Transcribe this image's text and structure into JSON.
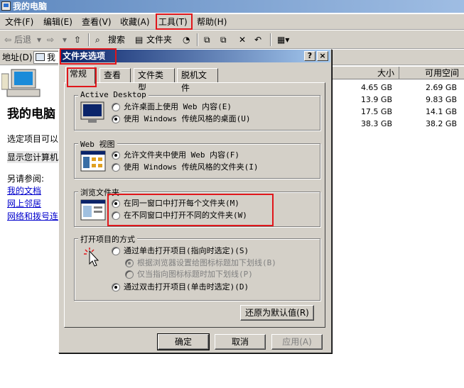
{
  "window": {
    "title": "我的电脑"
  },
  "menu": [
    "文件(F)",
    "编辑(E)",
    "查看(V)",
    "收藏(A)",
    "工具(T)",
    "帮助(H)"
  ],
  "toolbar": {
    "back": "后退",
    "search": "搜索",
    "folders": "文件夹"
  },
  "address": {
    "label": "地址(D)",
    "value": "我"
  },
  "leftpane": {
    "title": "我的电脑",
    "select_text": "选定项目可以",
    "show_text": "显示您计算机",
    "see_also": "另请参阅:",
    "links": [
      "我的文档",
      "网上邻居",
      "网络和拨号连"
    ]
  },
  "grid": {
    "headers": [
      "大小",
      "可用空间"
    ],
    "rows": [
      [
        "4.65 GB",
        "2.69 GB"
      ],
      [
        "13.9 GB",
        "9.83 GB"
      ],
      [
        "17.5 GB",
        "14.1 GB"
      ],
      [
        "38.3 GB",
        "38.2 GB"
      ]
    ]
  },
  "dialog": {
    "title": "文件夹选项",
    "help_btn": "?",
    "close_btn": "×",
    "tabs": [
      "常规",
      "查看",
      "文件类型",
      "脱机文件"
    ],
    "groups": {
      "active_desktop": {
        "title": "Active Desktop",
        "options": [
          "允许桌面上使用 Web 内容(E)",
          "使用 Windows 传统风格的桌面(U)"
        ],
        "selected": 1
      },
      "web_view": {
        "title": "Web 视图",
        "options": [
          "允许文件夹中使用 Web 内容(F)",
          "使用 Windows 传统风格的文件夹(I)"
        ],
        "selected": 0
      },
      "browse": {
        "title": "浏览文件夹",
        "options": [
          "在同一窗口中打开每个文件夹(M)",
          "在不同窗口中打开不同的文件夹(W)"
        ],
        "selected": 0
      },
      "click": {
        "title": "打开项目的方式",
        "options": [
          "通过单击打开项目(指向时选定)(S)",
          "根据浏览器设置给图标标题加下划线(B)",
          "仅当指向图标标题时加下划线(P)",
          "通过双击打开项目(单击时选定)(D)"
        ],
        "selected": 3
      }
    },
    "restore_btn": "还原为默认值(R)",
    "ok_btn": "确定",
    "cancel_btn": "取消",
    "apply_btn": "应用(A)"
  },
  "colors": {
    "highlight": "#e0161b",
    "dialog_title": "#0a246a",
    "face": "#d4d0c8"
  }
}
